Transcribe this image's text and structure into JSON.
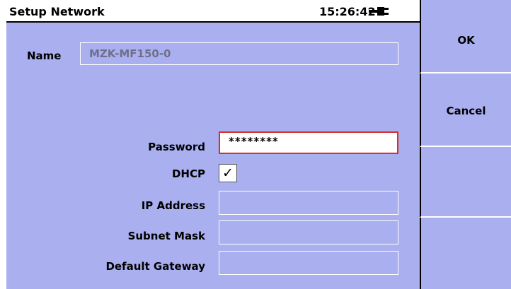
{
  "window": {
    "title": "Setup Network",
    "clock": "15:26:42",
    "power_icon": "ac-plug-icon"
  },
  "form": {
    "name_label": "Name",
    "name_value": "MZK-MF150-0",
    "password_label": "Password",
    "password_value": "********",
    "dhcp_label": "DHCP",
    "dhcp_checked": true,
    "dhcp_mark": "✓",
    "ip_label": "IP Address",
    "ip_value": "",
    "subnet_label": "Subnet Mask",
    "subnet_value": "",
    "gateway_label": "Default Gateway",
    "gateway_value": ""
  },
  "softkeys": {
    "ok_label": "OK",
    "cancel_label": "Cancel"
  },
  "colors": {
    "background": "#aab0ef",
    "field_border_focus": "#d62f2f",
    "title_bar": "#ffffff"
  }
}
